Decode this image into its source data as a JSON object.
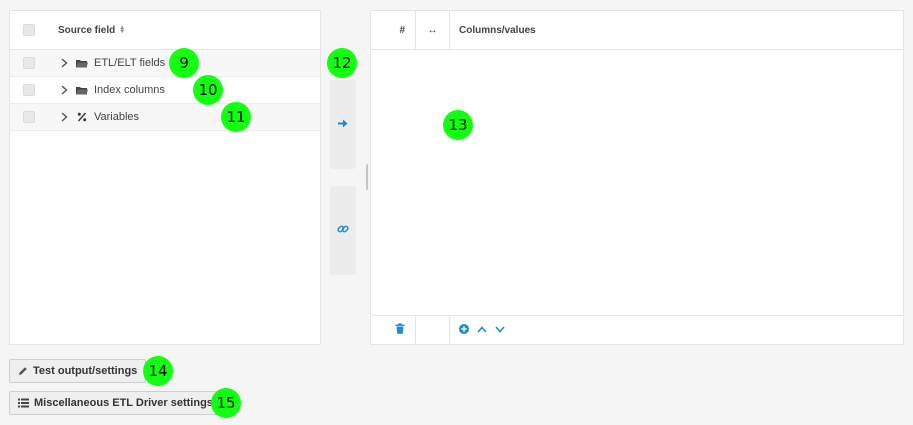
{
  "source_panel": {
    "header_label": "Source field",
    "items": [
      {
        "label": "ETL/ELT fields",
        "icon": "folder-icon"
      },
      {
        "label": "Index columns",
        "icon": "folder-icon"
      },
      {
        "label": "Variables",
        "icon": "percent-icon"
      }
    ]
  },
  "target_panel": {
    "col_hash": "#",
    "col_arrow": "↔",
    "col_columns": "Columns/values"
  },
  "buttons": {
    "test_output": "Test output/settings",
    "misc_settings": "Miscellaneous ETL Driver settings"
  },
  "badges": {
    "b9": "9",
    "b10": "10",
    "b11": "11",
    "b12": "12",
    "b13": "13",
    "b14": "14",
    "b15": "15"
  },
  "colors": {
    "accent": "#1a8bd6",
    "badge": "#12ff12"
  }
}
